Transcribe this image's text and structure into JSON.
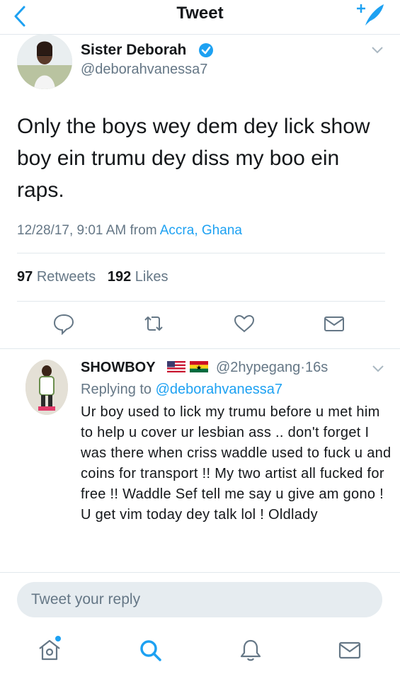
{
  "nav": {
    "title": "Tweet",
    "back_icon": "chevron-left-icon",
    "compose_icon": "compose-quill-icon"
  },
  "tweet": {
    "author_name": "Sister Deborah",
    "author_handle": "@deborahvanessa7",
    "text": "Only the boys wey dem dey lick show boy ein trumu dey diss my boo ein raps.",
    "timestamp": "12/28/17, 9:01 AM",
    "from_label": "from",
    "location": "Accra, Ghana",
    "retweets": "97",
    "retweets_label": "Retweets",
    "likes": "192",
    "likes_label": "Likes"
  },
  "reply": {
    "author_name": "SHOWBOY",
    "author_handle": "@2hypegang",
    "separator": "·",
    "time": "16s",
    "replying_to_label": "Replying to",
    "replying_to_handle": "@deborahvanessa7",
    "text": "Ur boy used to lick my trumu before u met him to help u cover ur lesbian ass .. don't forget I was there when criss waddle used to fuck u and coins for transport !! My two artist all fucked for free !! Waddle Sef tell me say u give am gono ! U get vim today dey talk lol ! Oldlady"
  },
  "compose": {
    "placeholder": "Tweet your reply"
  },
  "colors": {
    "accent": "#1da1f2",
    "secondary_text": "#657786",
    "divider": "#e1e8ed",
    "verified": "#1da1f2"
  }
}
